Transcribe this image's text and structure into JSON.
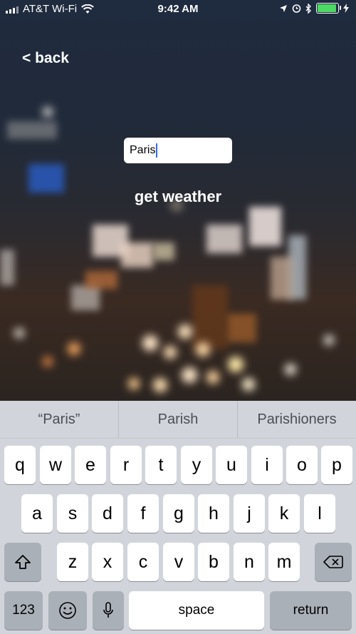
{
  "status_bar": {
    "carrier": "AT&T Wi-Fi",
    "time": "9:42 AM"
  },
  "nav": {
    "back_label": "< back"
  },
  "form": {
    "city_value": "Paris",
    "submit_label": "get weather"
  },
  "keyboard": {
    "suggestions": [
      "“Paris”",
      "Parish",
      "Parishioners"
    ],
    "row1": [
      "q",
      "w",
      "e",
      "r",
      "t",
      "y",
      "u",
      "i",
      "o",
      "p"
    ],
    "row2": [
      "a",
      "s",
      "d",
      "f",
      "g",
      "h",
      "j",
      "k",
      "l"
    ],
    "row3": [
      "z",
      "x",
      "c",
      "v",
      "b",
      "n",
      "m"
    ],
    "numbers_label": "123",
    "space_label": "space",
    "return_label": "return"
  },
  "colors": {
    "battery": "#4cd964",
    "caret": "#2f6bff",
    "keyboard_bg": "#d1d5db"
  }
}
